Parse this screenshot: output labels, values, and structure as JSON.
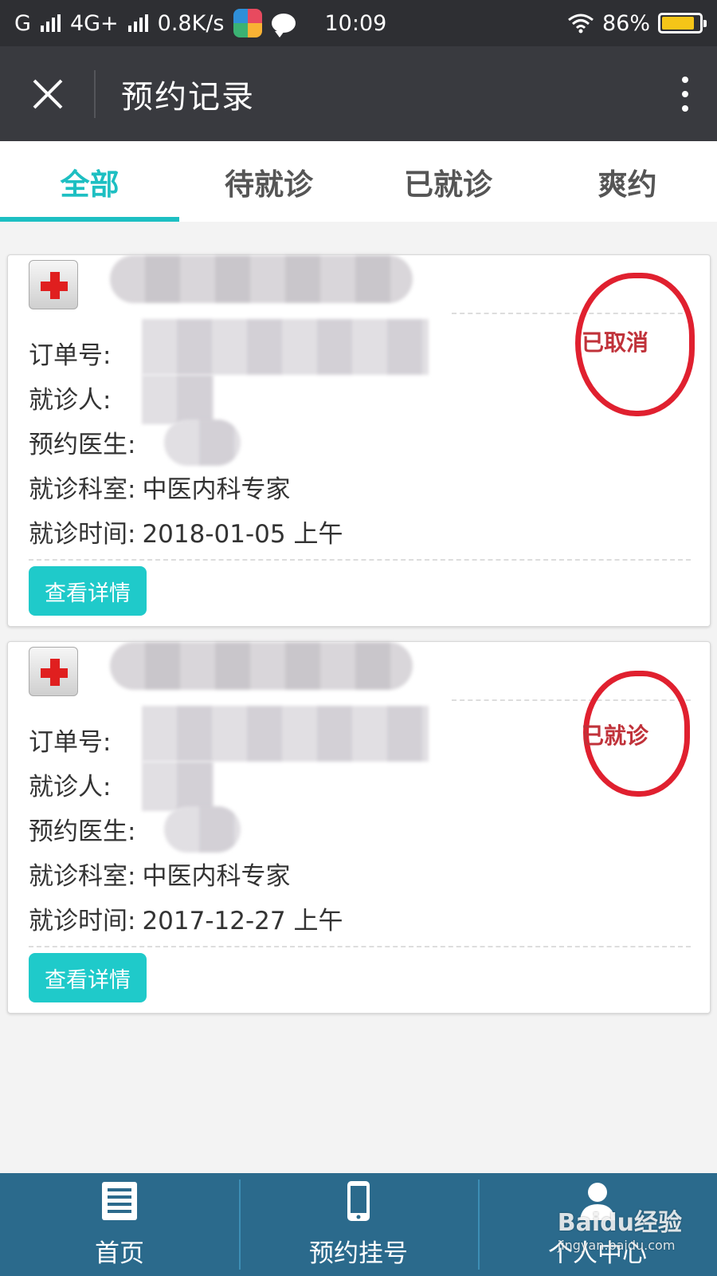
{
  "status_bar": {
    "carrier": "G",
    "network": "4G+",
    "speed": "0.8K/s",
    "time": "10:09",
    "battery": "86%",
    "battery_level": 0.86
  },
  "header": {
    "title": "预约记录",
    "close_icon": "close-icon",
    "more_icon": "more-vertical-icon"
  },
  "tabs": [
    {
      "label": "全部",
      "active": true
    },
    {
      "label": "待就诊",
      "active": false
    },
    {
      "label": "已就诊",
      "active": false
    },
    {
      "label": "爽约",
      "active": false
    }
  ],
  "labels": {
    "order_no": "订单号:",
    "patient": "就诊人:",
    "doctor": "预约医生:",
    "department": "就诊科室:",
    "visit_time": "就诊时间:"
  },
  "records": [
    {
      "status": "已取消",
      "department": "中医内科专家",
      "visit_time": "2018-01-05 上午",
      "detail_button": "查看详情"
    },
    {
      "status": "已就诊",
      "department": "中医内科专家",
      "visit_time": "2017-12-27 上午",
      "detail_button": "查看详情"
    }
  ],
  "bottom_nav": [
    {
      "label": "首页",
      "icon": "document-icon"
    },
    {
      "label": "预约挂号",
      "icon": "phone-icon"
    },
    {
      "label": "个人中心",
      "icon": "user-icon"
    }
  ],
  "watermark": {
    "brand": "Baidu经验",
    "url": "jingyan.baidu.com"
  },
  "colors": {
    "accent": "#1dbfc2",
    "status_red": "#c0323a",
    "nav_bg": "#2b6a8c",
    "titlebar_bg": "#393a3f"
  }
}
